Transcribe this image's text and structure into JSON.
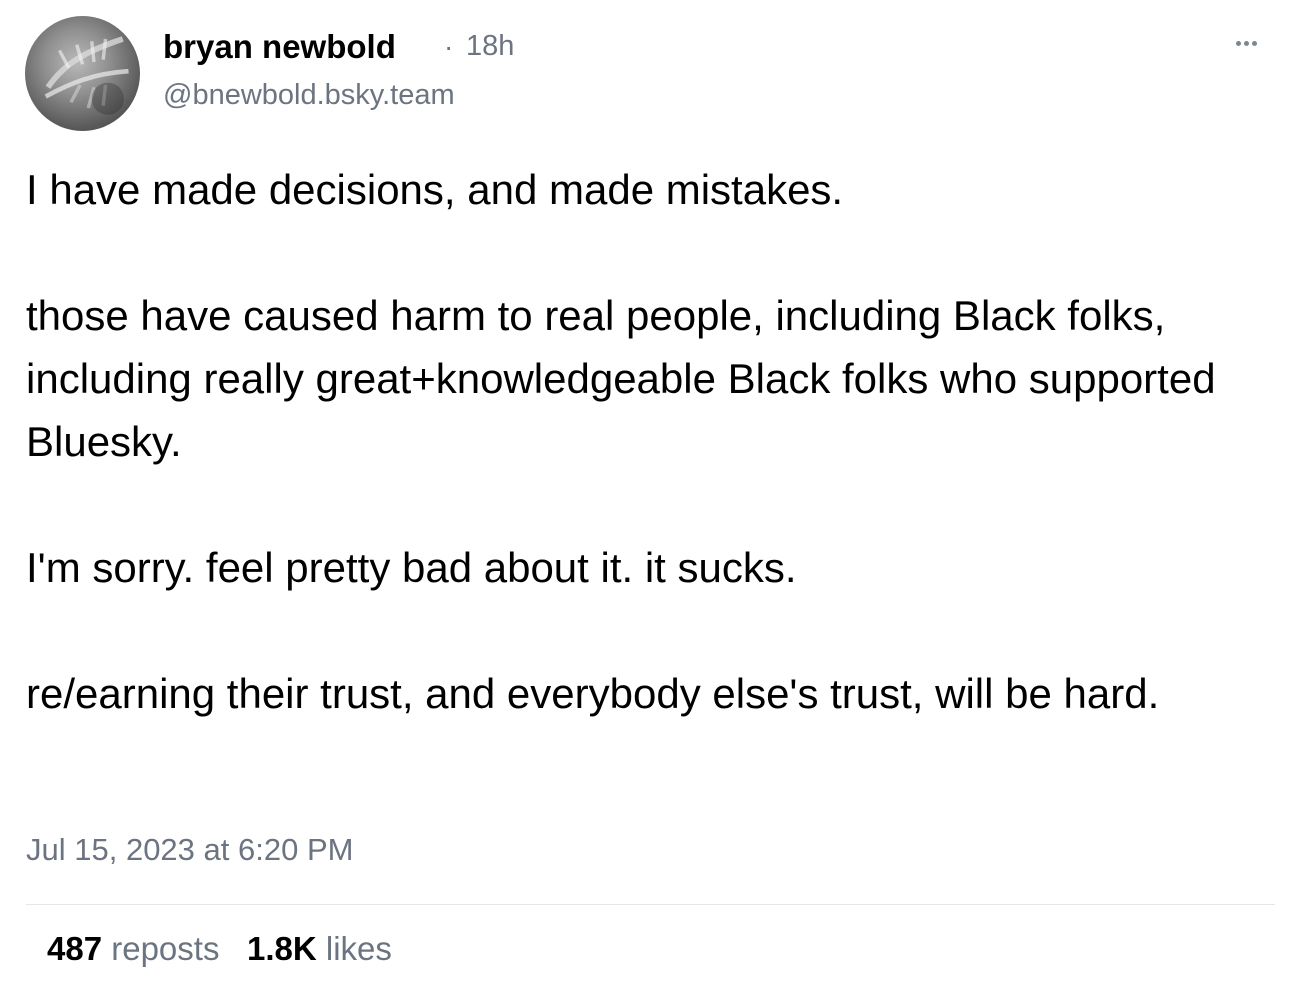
{
  "post": {
    "author": {
      "display_name": "bryan newbold",
      "handle": "@bnewbold.bsky.team",
      "avatar_icon": "avatar-photo"
    },
    "separator": "·",
    "relative_time": "18h",
    "more_icon": "ellipsis-icon",
    "paragraphs": [
      "I have made decisions, and made mistakes.",
      "those have caused harm to real people, including Black folks, including really great+knowledgeable Black folks who supported Bluesky.",
      "I'm sorry. feel pretty bad about it. it sucks.",
      "re/earning their trust, and everybody else's trust, will be hard."
    ],
    "timestamp": "Jul 15, 2023 at 6:20 PM",
    "stats": {
      "reposts_count": "487",
      "reposts_label": "reposts",
      "likes_count": "1.8K",
      "likes_label": "likes"
    }
  },
  "colors": {
    "text": "#000000",
    "secondary": "#6b7480",
    "divider": "#e3e6ea"
  }
}
